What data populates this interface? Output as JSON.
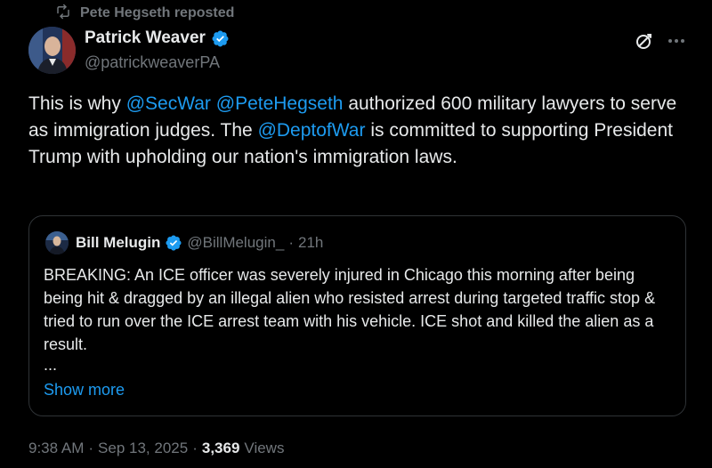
{
  "repost": {
    "text": "Pete Hegseth reposted",
    "icon": "repost-icon"
  },
  "author": {
    "display_name": "Patrick Weaver",
    "handle": "@patrickweaverPA",
    "verified_color": "#1d9bf0"
  },
  "tweet": {
    "t1": "This is why ",
    "m1": "@SecWar",
    "t2": " ",
    "m2": "@PeteHegseth",
    "t3": " authorized 600 military lawyers to serve as immigration judges. The ",
    "m3": "@DeptofWar",
    "t4": " is committed to supporting President Trump with upholding our nation's immigration laws."
  },
  "quote": {
    "display_name": "Bill Melugin",
    "handle": "@BillMelugin_",
    "separator": "·",
    "time": "21h",
    "text": "BREAKING: An ICE officer was severely injured in Chicago this morning after being being hit & dragged by an illegal alien who resisted arrest during targeted traffic stop & tried to run over the ICE arrest team with his vehicle. ICE shot and killed the alien as a result.",
    "ellipsis": "...",
    "show_more": "Show more"
  },
  "meta": {
    "time": "9:38 AM",
    "sep1": "·",
    "date": "Sep 13, 2025",
    "sep2": "·",
    "views_count": "3,369",
    "views_label": "Views"
  },
  "colors": {
    "background": "#000000",
    "text": "#e7e9ea",
    "muted": "#71767b",
    "link": "#1d9bf0",
    "border": "#2f3336"
  }
}
